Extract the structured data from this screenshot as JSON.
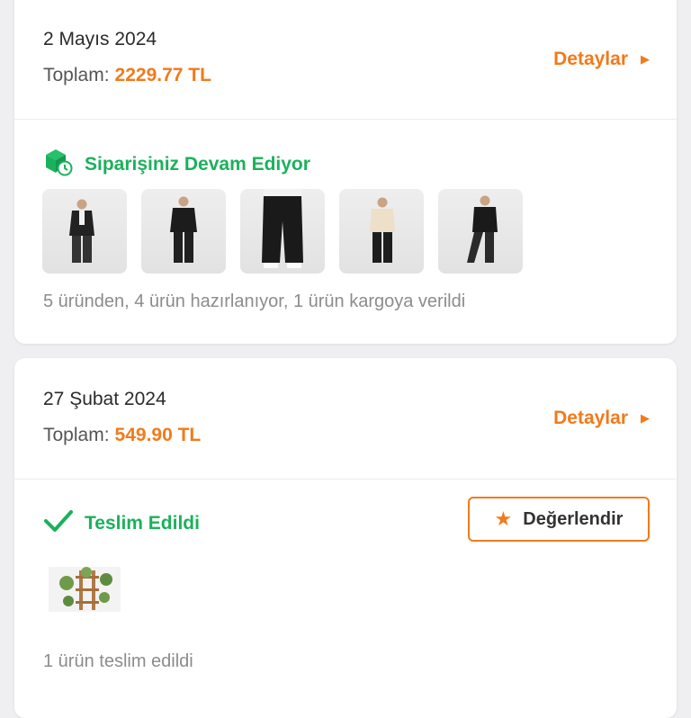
{
  "orders": [
    {
      "date": "2 Mayıs 2024",
      "total_label": "Toplam:",
      "total_value": "2229.77 TL",
      "details_label": "Detaylar",
      "status": "Siparişiniz Devam Ediyor",
      "summary": "5 üründen, 4 ürün hazırlanıyor, 1 ürün kargoya verildi"
    },
    {
      "date": "27 Şubat 2024",
      "total_label": "Toplam:",
      "total_value": "549.90 TL",
      "details_label": "Detaylar",
      "status": "Teslim Edildi",
      "rate_label": "Değerlendir",
      "summary": "1 ürün teslim edildi"
    }
  ],
  "colors": {
    "accent": "#f27a1a",
    "success": "#1bb15c",
    "background": "#efeff1"
  }
}
